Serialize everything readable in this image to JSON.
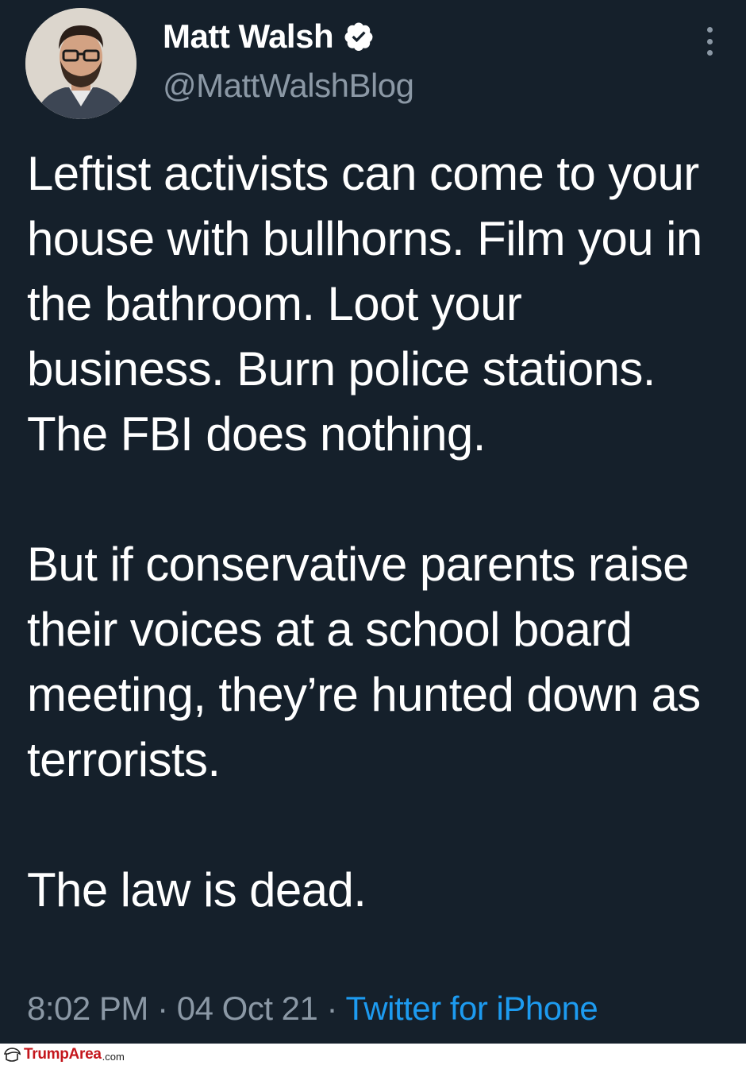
{
  "tweet": {
    "display_name": "Matt Walsh",
    "handle": "@MattWalshBlog",
    "paragraphs": [
      "Leftist activists can come to your house with bullhorns. Film you in the bathroom. Loot your business. Burn police stations. The FBI does nothing.",
      "But if conservative parents raise their voices at a school board meeting, they’re hunted down as terrorists.",
      "The law is dead."
    ],
    "time": "8:02 PM",
    "separator": "·",
    "date": "04 Oct 21",
    "source": "Twitter for iPhone"
  },
  "icons": {
    "verified": "verified-badge-icon",
    "more": "more-options-icon"
  },
  "colors": {
    "background": "#15202b",
    "text": "#ffffff",
    "secondary_text": "#8b98a5",
    "link": "#1d9bf0",
    "watermark": "#c4161c"
  },
  "watermark": {
    "brand": "TrumpArea",
    "tld": ".com"
  }
}
